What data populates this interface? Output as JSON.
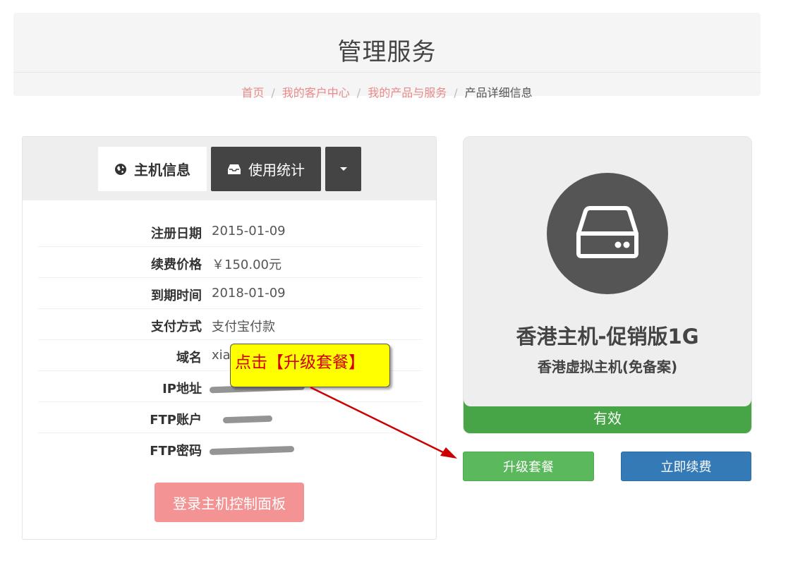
{
  "header": {
    "title": "管理服务",
    "breadcrumb": [
      {
        "label": "首页"
      },
      {
        "label": "我的客户中心"
      },
      {
        "label": "我的产品与服务"
      },
      {
        "label": "产品详细信息"
      }
    ],
    "separator": "/"
  },
  "tabs": {
    "host_info": {
      "label": "主机信息",
      "icon": "globe-icon"
    },
    "usage_stats": {
      "label": "使用统计",
      "icon": "inbox-icon"
    },
    "more": {
      "icon": "caret-down-icon"
    }
  },
  "info": {
    "reg_date": {
      "label": "注册日期",
      "value": "2015-01-09"
    },
    "renew_price": {
      "label": "续费价格",
      "value": "￥150.00元"
    },
    "expire_date": {
      "label": "到期时间",
      "value": "2018-01-09"
    },
    "payment": {
      "label": "支付方式",
      "value": "支付宝付款"
    },
    "domain": {
      "label": "域名",
      "value": "xia"
    },
    "ip": {
      "label": "IP地址",
      "value": ""
    },
    "ftp_user": {
      "label": "FTP账户",
      "value": ""
    },
    "ftp_password": {
      "label": "FTP密码",
      "value": ""
    }
  },
  "login_button": "登录主机控制面板",
  "callout": "点击【升级套餐】",
  "product": {
    "name": "香港主机-促销版1G",
    "type": "香港虚拟主机(免备案)",
    "status": "有效",
    "icon": "hard-drive-icon"
  },
  "actions": {
    "upgrade": "升级套餐",
    "renew": "立即续费"
  },
  "colors": {
    "accent_link": "#e98a8a",
    "dark_tab": "#444444",
    "status_green": "#47a447",
    "upgrade_green": "#5cb85c",
    "renew_blue": "#337ab7",
    "login_pink": "#f39393",
    "callout_yellow": "#ffff00",
    "callout_text": "#d40000",
    "arrow_red": "#cc0000"
  }
}
